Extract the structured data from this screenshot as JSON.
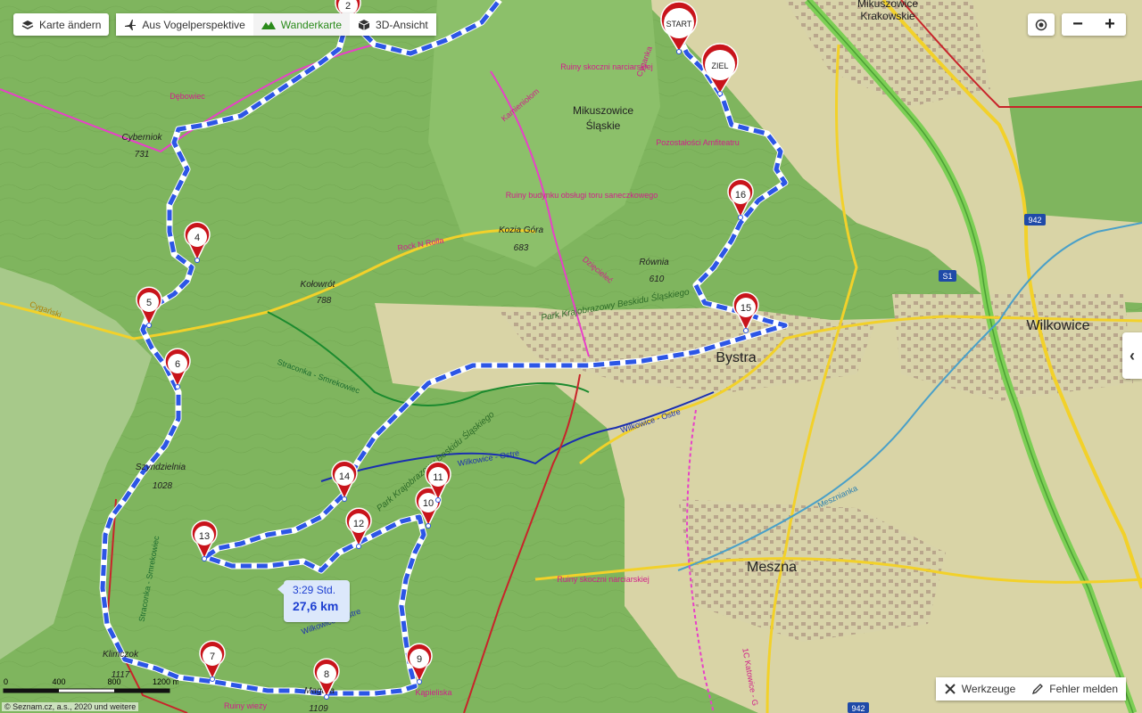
{
  "toolbar": {
    "change_map": "Karte ändern",
    "aerial": "Aus Vogelperspektive",
    "hiking": "Wanderkarte",
    "view3d": "3D-Ansicht"
  },
  "zoom": {
    "plus": "+",
    "minus": "−"
  },
  "side_tab": "‹",
  "route_info": {
    "time": "3:29 Std.",
    "distance": "27,6 km"
  },
  "tools": {
    "tools_label": "Werkzeuge",
    "report_label": "Fehler melden"
  },
  "scale": {
    "labels": [
      "0",
      "400",
      "800",
      "1200 m"
    ]
  },
  "copyright": "© Seznam.cz, a.s., 2020 und weitere",
  "markers": {
    "start": "START",
    "ziel": "ZIEL",
    "m2": "2",
    "m4": "4",
    "m5": "5",
    "m6": "6",
    "m7": "7",
    "m8": "8",
    "m9": "9",
    "m10": "10",
    "m11": "11",
    "m12": "12",
    "m13": "13",
    "m14": "14",
    "m15": "15",
    "m16": "16"
  },
  "places": {
    "mikuszowice_krakowskie_1": "Mikuszowice",
    "mikuszowice_krakowskie_2": "Krakowskie",
    "mikuszowice_slaskie_1": "Mikuszowice",
    "mikuszowice_slaskie_2": "Śląskie",
    "bystra": "Bystra",
    "wilkowice": "Wilkowice",
    "meszna": "Meszna",
    "cyberniok": "Cyberniok",
    "cyberniok_h": "731",
    "kolowrot": "Kołowrót",
    "kolowrot_h": "788",
    "kozia_gora": "Kozia Góra",
    "kozia_gora_h": "683",
    "rownia": "Równia",
    "rownia_h": "610",
    "szyndzielnia": "Szyndzielnia",
    "szyndzielnia_h": "1028",
    "klimczok": "Klimczok",
    "klimczok_h": "1117",
    "magura": "Magura",
    "magura_h": "1109",
    "park1": "Park Krajobrazowy Beskidu Śląskiego",
    "park2": "Park Krajobrazowy Beskidu Śląskiego",
    "ruiny_narciarskiej": "Ruiny skoczni narciarskiej",
    "ruiny_budynku": "Ruiny budynku obsługi toru saneczkowego",
    "pozostalosci": "Pozostałości Amfiteatru",
    "ruiny_narciarskiej2": "Ruiny skoczni narciarskiej",
    "ruiny_wiezy": "Ruiny wieży",
    "debowiec": "Dębowiec",
    "rock_n_roll": "Rock N Rolla",
    "straconka1": "Straconka - Smrekowiec",
    "straconka2": "Straconka - Smrekowiec",
    "wilkowice_ostre1": "Wilkowice - Ostre",
    "wilkowice_ostre2": "Wilkowice - Ostre",
    "wilkowice_ostre3": "Wilkowice - Ostre",
    "mesznianka": "Mesznianka",
    "road_942_1": "942",
    "road_942_2": "942",
    "road_s1": "S1",
    "cygan": "Cygański",
    "kamieniolom": "Kamieniołom",
    "cyganka": "Cyganka",
    "dziecielec": "Dzięcieleć",
    "kapieliska": "Kąpieliska",
    "katowice": "1C Katowice - G"
  },
  "colors": {
    "forest": "#7fb55e",
    "meadow": "#d9d4a6",
    "route": "#2c56e6",
    "marker": "#c8141b",
    "road_yellow": "#f2d12a",
    "expressway": "#7ccf55"
  },
  "icons": {
    "map_change": "layers-icon",
    "aerial": "plane-icon",
    "hiking": "mountain-icon",
    "view3d": "cube-icon",
    "locate": "locate-icon",
    "tools": "tools-icon",
    "report": "pencil-icon"
  }
}
